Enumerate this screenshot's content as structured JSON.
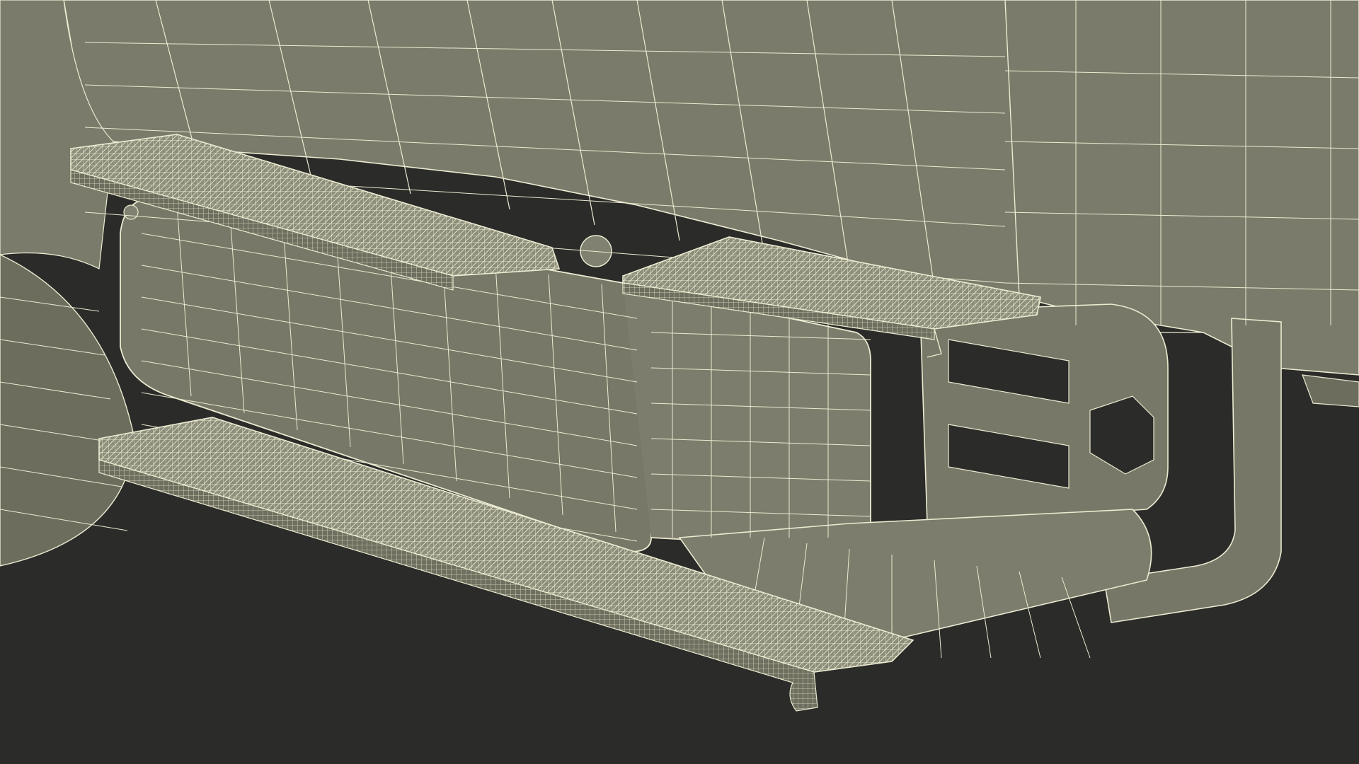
{
  "scene": {
    "subject": "truck-side-wireframe-render",
    "colors": {
      "background": "#2b2b29",
      "body_fill": "#7a7b6a",
      "body_fill_dark": "#6c6d5d",
      "tank_fill": "#777867",
      "step_fill": "#8a8b78",
      "wire": "#ecebd2",
      "wire_dense": "#e3e2c6"
    }
  }
}
